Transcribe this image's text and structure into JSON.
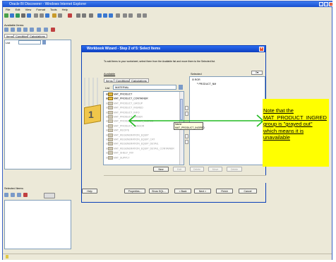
{
  "window": {
    "title": "Oracle BI Discoverer - Windows Internet Explorer",
    "menu": [
      "File",
      "Edit",
      "View",
      "Format",
      "Tools",
      "Help"
    ]
  },
  "left_panel": {
    "available_label": "Available Items:",
    "tabs": [
      "Items",
      "Conditions",
      "Calculations"
    ],
    "list_label": "List",
    "selected_label": "Selected Items:"
  },
  "wizard": {
    "title": "Workbook Wizard - Step 2 of 5: Select Items",
    "instruction": "To add items to your worksheet, select them from the Available list and move them to the Selected list.",
    "available_label": "Available",
    "selected_label": "Selected",
    "tabs": [
      "Items",
      "Conditions",
      "Calculations"
    ],
    "list_label": "List",
    "list_value": "MATERIAL",
    "tree_items": [
      {
        "label": "MAT_PRODUCT",
        "grayed": false
      },
      {
        "label": "MAT_PRODUCT_CONTAINER",
        "grayed": false
      },
      {
        "label": "MAT_PRODUCT_GROUP",
        "grayed": true
      },
      {
        "label": "MAT_PRODUCT_INGRED",
        "grayed": true
      },
      {
        "label": "MAT_PRODUCT_INFO",
        "grayed": true
      },
      {
        "label": "MAT_PRODUCT_ORDER",
        "grayed": true
      },
      {
        "label": "MAT_PRODUCT_ORDER_INGRED",
        "grayed": true
      },
      {
        "label": "MAT_PRODUCT_VENDOR",
        "grayed": true
      },
      {
        "label": "MAT_RECIPE",
        "grayed": true
      },
      {
        "label": "MAT_REGENERATION_EQUIP",
        "grayed": true
      },
      {
        "label": "MAT_REGENERATION_EQUIP_CAT",
        "grayed": true
      },
      {
        "label": "MAT_REGENERATION_EQUIP_DETAIL",
        "grayed": true
      },
      {
        "label": "MAT_REGENERATION_EQUIP_DETAIL_CONTAINER",
        "grayed": true
      },
      {
        "label": "MAT_SHELF_INV",
        "grayed": true
      },
      {
        "label": "MAT_SUPPLY",
        "grayed": true
      }
    ],
    "selected_items": [
      "ROR",
      "PRODUCT_NM"
    ],
    "tooltip": {
      "line1": "Name",
      "line2": "MAT_PRODUCT_INGRED"
    },
    "buttons_row1": {
      "new": "New",
      "edit": "Edit",
      "delete": "Delete",
      "move_up": "Move",
      "move_down": "Delete"
    },
    "buttons_row2": {
      "help": "Help",
      "properties": "Properties...",
      "show_sql": "Show SQL...",
      "back": "< Back",
      "next": "Next >",
      "finish": "Finish",
      "cancel": "Cancel"
    }
  },
  "annotation": {
    "text": "Note that the MAT_PRODUCT_INGRED group is \"grayed out\" which means it is unavailable",
    "color": "#ffff00",
    "arrow_color": "#22bb22"
  }
}
